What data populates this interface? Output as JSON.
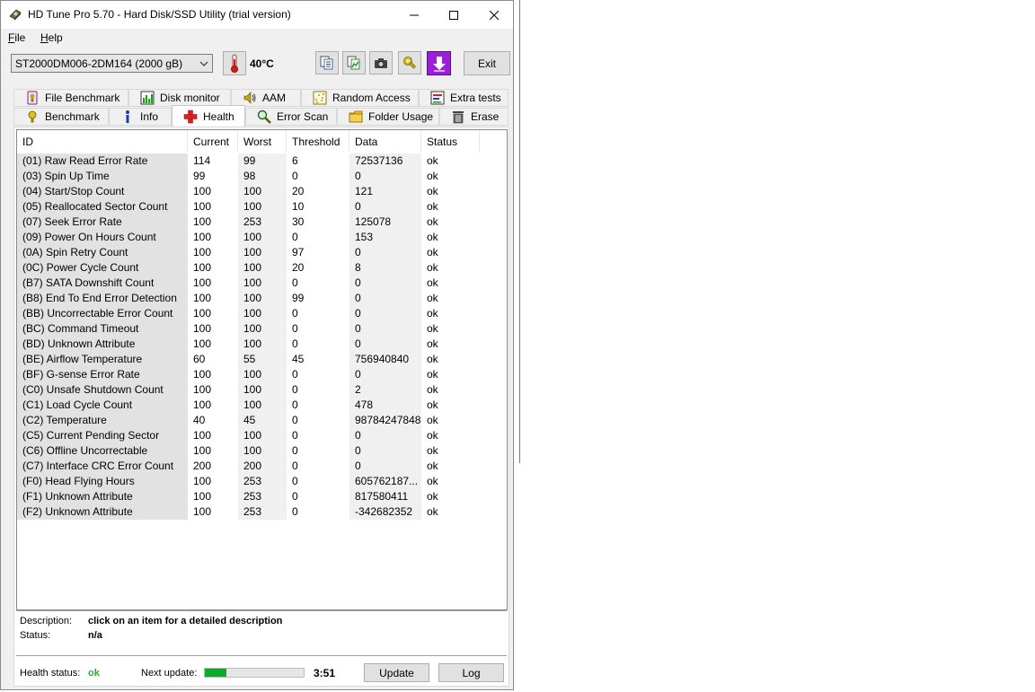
{
  "window": {
    "title": "HD Tune Pro 5.70 - Hard Disk/SSD Utility (trial version)"
  },
  "menu": {
    "file": "File",
    "file_accel": "F",
    "file_rest": "ile",
    "help": "Help",
    "help_accel": "H",
    "help_rest": "elp"
  },
  "toolbar": {
    "drive": "ST2000DM006-2DM164 (2000 gB)",
    "temperature": "40°C",
    "exit_label": "Exit"
  },
  "tabs_top": [
    {
      "label": "File Benchmark",
      "icon": "file-benchmark-icon"
    },
    {
      "label": "Disk monitor",
      "icon": "disk-monitor-icon"
    },
    {
      "label": "AAM",
      "icon": "speaker-icon"
    },
    {
      "label": "Random Access",
      "icon": "random-access-icon"
    },
    {
      "label": "Extra tests",
      "icon": "extra-tests-icon"
    }
  ],
  "tabs_bottom": [
    {
      "label": "Benchmark",
      "icon": "benchmark-icon"
    },
    {
      "label": "Info",
      "icon": "info-icon"
    },
    {
      "label": "Health",
      "icon": "health-cross-icon",
      "active": true
    },
    {
      "label": "Error Scan",
      "icon": "magnifier-icon"
    },
    {
      "label": "Folder Usage",
      "icon": "folder-icon"
    },
    {
      "label": "Erase",
      "icon": "trash-icon"
    }
  ],
  "table": {
    "columns": [
      "ID",
      "Current",
      "Worst",
      "Threshold",
      "Data",
      "Status"
    ],
    "rows": [
      [
        "(01) Raw Read Error Rate",
        "114",
        "99",
        "6",
        "72537136",
        "ok"
      ],
      [
        "(03) Spin Up Time",
        "99",
        "98",
        "0",
        "0",
        "ok"
      ],
      [
        "(04) Start/Stop Count",
        "100",
        "100",
        "20",
        "121",
        "ok"
      ],
      [
        "(05) Reallocated Sector Count",
        "100",
        "100",
        "10",
        "0",
        "ok"
      ],
      [
        "(07) Seek Error Rate",
        "100",
        "253",
        "30",
        "125078",
        "ok"
      ],
      [
        "(09) Power On Hours Count",
        "100",
        "100",
        "0",
        "153",
        "ok"
      ],
      [
        "(0A) Spin Retry Count",
        "100",
        "100",
        "97",
        "0",
        "ok"
      ],
      [
        "(0C) Power Cycle Count",
        "100",
        "100",
        "20",
        "8",
        "ok"
      ],
      [
        "(B7) SATA Downshift Count",
        "100",
        "100",
        "0",
        "0",
        "ok"
      ],
      [
        "(B8) End To End Error Detection",
        "100",
        "100",
        "99",
        "0",
        "ok"
      ],
      [
        "(BB) Uncorrectable Error Count",
        "100",
        "100",
        "0",
        "0",
        "ok"
      ],
      [
        "(BC) Command Timeout",
        "100",
        "100",
        "0",
        "0",
        "ok"
      ],
      [
        "(BD) Unknown Attribute",
        "100",
        "100",
        "0",
        "0",
        "ok"
      ],
      [
        "(BE) Airflow Temperature",
        "60",
        "55",
        "45",
        "756940840",
        "ok"
      ],
      [
        "(BF) G-sense Error Rate",
        "100",
        "100",
        "0",
        "0",
        "ok"
      ],
      [
        "(C0) Unsafe Shutdown Count",
        "100",
        "100",
        "0",
        "2",
        "ok"
      ],
      [
        "(C1) Load Cycle Count",
        "100",
        "100",
        "0",
        "478",
        "ok"
      ],
      [
        "(C2) Temperature",
        "40",
        "45",
        "0",
        "98784247848",
        "ok"
      ],
      [
        "(C5) Current Pending Sector",
        "100",
        "100",
        "0",
        "0",
        "ok"
      ],
      [
        "(C6) Offline Uncorrectable",
        "100",
        "100",
        "0",
        "0",
        "ok"
      ],
      [
        "(C7) Interface CRC Error Count",
        "200",
        "200",
        "0",
        "0",
        "ok"
      ],
      [
        "(F0) Head Flying Hours",
        "100",
        "253",
        "0",
        "605762187...",
        "ok"
      ],
      [
        "(F1) Unknown Attribute",
        "100",
        "253",
        "0",
        "817580411",
        "ok"
      ],
      [
        "(F2) Unknown Attribute",
        "100",
        "253",
        "0",
        "-342682352",
        "ok"
      ]
    ]
  },
  "details": {
    "description_label": "Description:",
    "description_value": "click on an item for a detailed description",
    "status_label": "Status:",
    "status_value": "n/a"
  },
  "footer": {
    "health_label": "Health status:",
    "health_value": "ok",
    "next_update_label": "Next update:",
    "next_update_progress": 0.22,
    "countdown": "3:51",
    "update_label": "Update",
    "log_label": "Log"
  },
  "colors": {
    "health_ok": "#2ea82e",
    "progress": "#06b025",
    "purple_button": "#9b1fd6"
  }
}
